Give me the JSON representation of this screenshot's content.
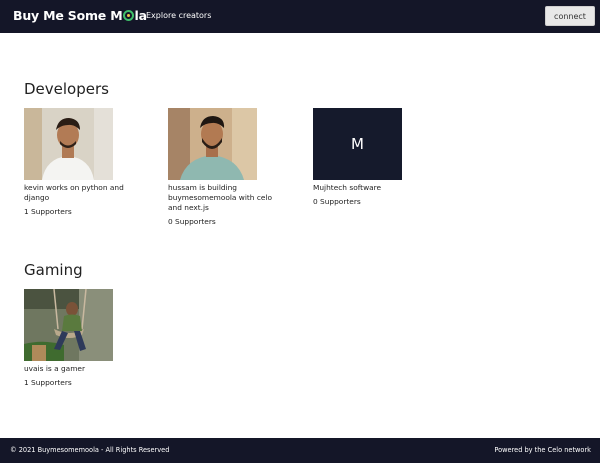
{
  "navbar": {
    "brand_before": "Buy Me Some M",
    "brand_after": "la",
    "explore_link": "Explore creators",
    "connect_button": "connect"
  },
  "sections": [
    {
      "title": "Developers",
      "cards": [
        {
          "description": "kevin works on python and django",
          "supporters": "1 Supporters",
          "avatar": "photo"
        },
        {
          "description": "hussam is building buymesomemoola with celo and next.js",
          "supporters": "0 Supporters",
          "avatar": "photo"
        },
        {
          "description": "Mujhtech software",
          "supporters": "0 Supporters",
          "avatar_letter": "M"
        }
      ]
    },
    {
      "title": "Gaming",
      "cards": [
        {
          "description": "uvais is a gamer",
          "supporters": "1 Supporters",
          "avatar": "photo"
        }
      ]
    }
  ],
  "footer": {
    "copyright": "© 2021 Buymesomemoola - All Rights Reserved",
    "powered_by": "Powered by the Celo network"
  },
  "colors": {
    "navbar_bg": "#141628",
    "logo_ring": "#3fbf6b",
    "logo_dot": "#e9c84a",
    "letter_avatar_bg": "#151a2c"
  }
}
